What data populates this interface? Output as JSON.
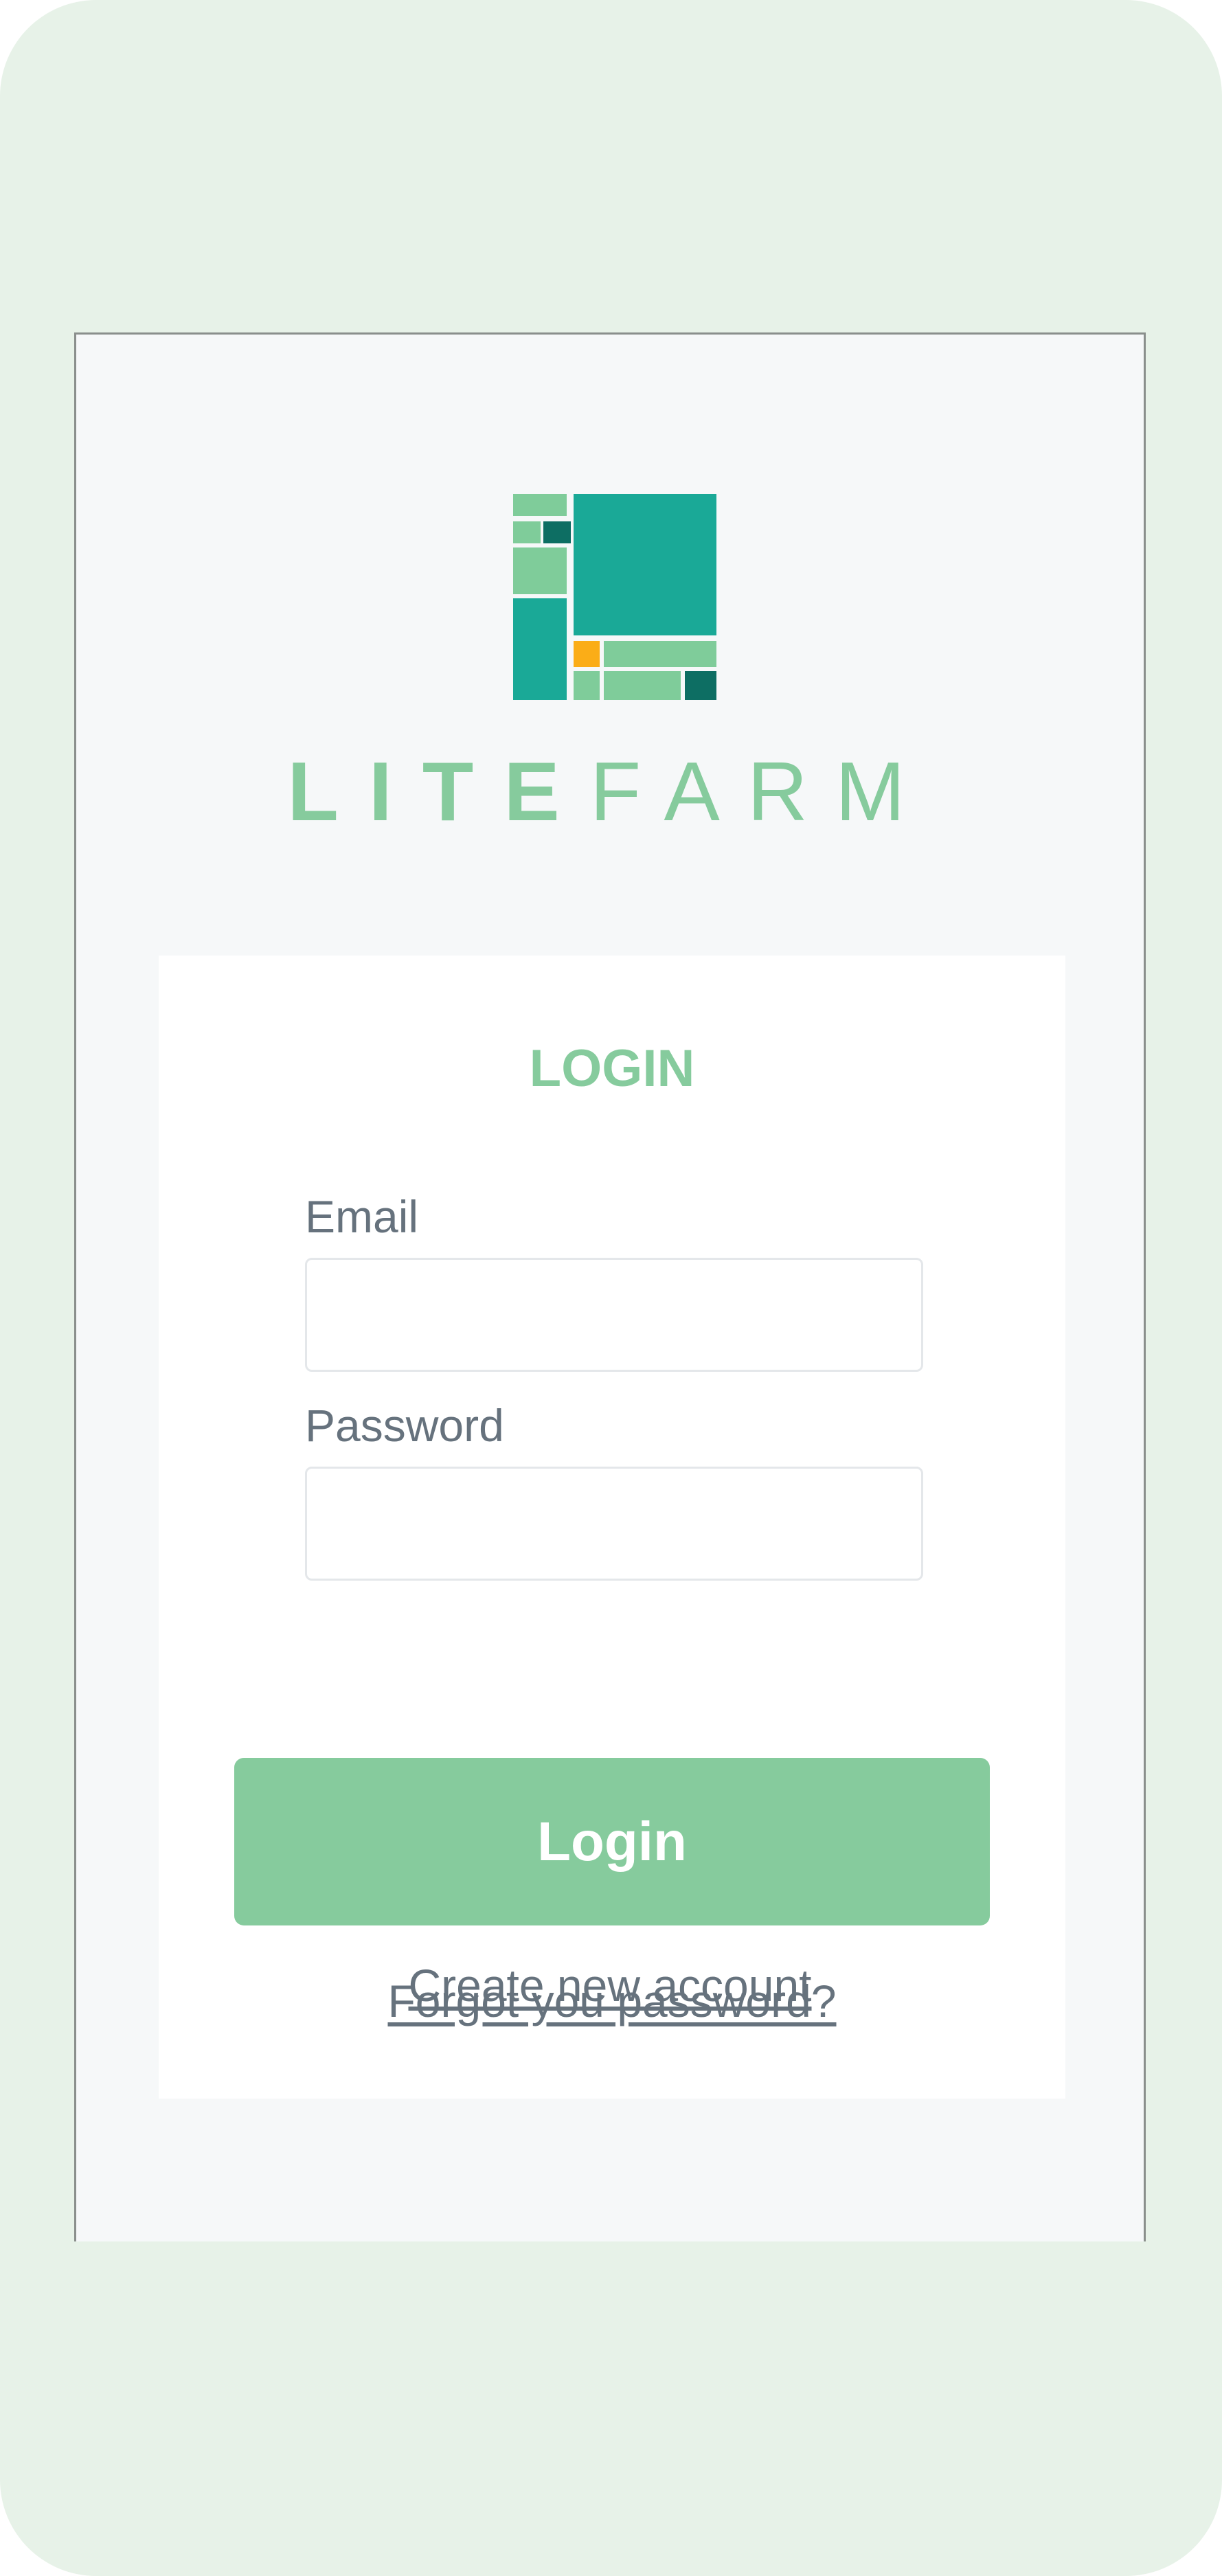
{
  "brand": {
    "name_part1": "LITE",
    "name_part2": "FARM",
    "colors": {
      "primary_green": "#86cb9d",
      "teal": "#1aa997",
      "dark_teal": "#0d6e63",
      "orange": "#fbad17",
      "light_green": "#7fcc9a",
      "background": "#e7f2e8"
    }
  },
  "login_card": {
    "title": "LOGIN",
    "email": {
      "label": "Email",
      "value": "",
      "placeholder": ""
    },
    "password": {
      "label": "Password",
      "value": "",
      "placeholder": ""
    },
    "submit_label": "Login",
    "forgot_password_label": "Forgot you password?",
    "create_account_label": "Create new account"
  }
}
